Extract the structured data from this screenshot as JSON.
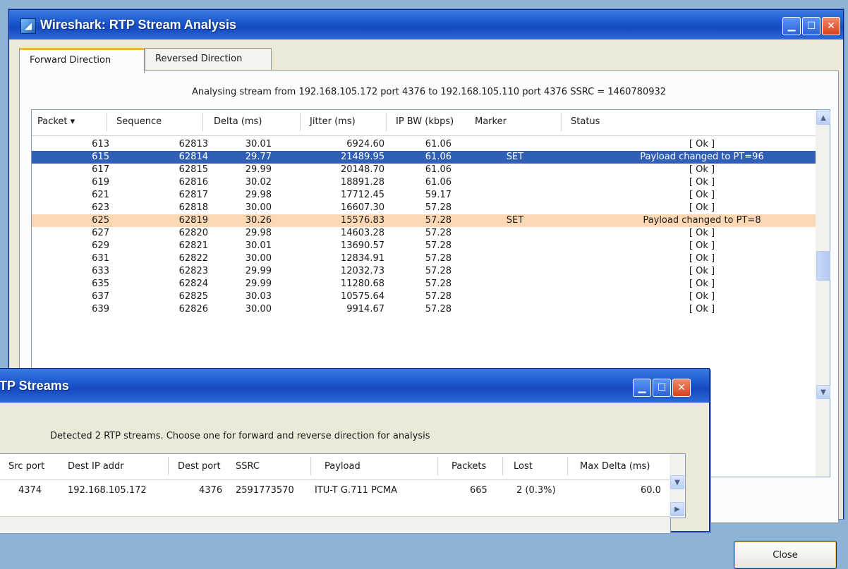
{
  "main_window": {
    "title": "Wireshark: RTP Stream Analysis",
    "tabs": [
      {
        "label": "Forward Direction",
        "active": true
      },
      {
        "label": "Reversed Direction",
        "active": false
      }
    ],
    "analysing_text": "Analysing stream from  192.168.105.172 port 4376  to  192.168.105.110 port 4376  SSRC = 1460780932",
    "columns": [
      "Packet ▾",
      "Sequence",
      "Delta (ms)",
      "Jitter (ms)",
      "IP BW (kbps)",
      "Marker",
      "Status"
    ],
    "rows": [
      {
        "packet": "613",
        "seq": "62813",
        "delta": "30.01",
        "jitter": "6924.60",
        "bw": "61.06",
        "marker": "",
        "status": "[ Ok ]",
        "state": "normal"
      },
      {
        "packet": "615",
        "seq": "62814",
        "delta": "29.77",
        "jitter": "21489.95",
        "bw": "61.06",
        "marker": "SET",
        "status": "Payload changed to PT=96",
        "state": "selected"
      },
      {
        "packet": "617",
        "seq": "62815",
        "delta": "29.99",
        "jitter": "20148.70",
        "bw": "61.06",
        "marker": "",
        "status": "[ Ok ]",
        "state": "normal"
      },
      {
        "packet": "619",
        "seq": "62816",
        "delta": "30.02",
        "jitter": "18891.28",
        "bw": "61.06",
        "marker": "",
        "status": "[ Ok ]",
        "state": "normal"
      },
      {
        "packet": "621",
        "seq": "62817",
        "delta": "29.98",
        "jitter": "17712.45",
        "bw": "59.17",
        "marker": "",
        "status": "[ Ok ]",
        "state": "normal"
      },
      {
        "packet": "623",
        "seq": "62818",
        "delta": "30.00",
        "jitter": "16607.30",
        "bw": "57.28",
        "marker": "",
        "status": "[ Ok ]",
        "state": "normal"
      },
      {
        "packet": "625",
        "seq": "62819",
        "delta": "30.26",
        "jitter": "15576.83",
        "bw": "57.28",
        "marker": "SET",
        "status": "Payload changed to PT=8",
        "state": "warning"
      },
      {
        "packet": "627",
        "seq": "62820",
        "delta": "29.98",
        "jitter": "14603.28",
        "bw": "57.28",
        "marker": "",
        "status": "[ Ok ]",
        "state": "normal"
      },
      {
        "packet": "629",
        "seq": "62821",
        "delta": "30.01",
        "jitter": "13690.57",
        "bw": "57.28",
        "marker": "",
        "status": "[ Ok ]",
        "state": "normal"
      },
      {
        "packet": "631",
        "seq": "62822",
        "delta": "30.00",
        "jitter": "12834.91",
        "bw": "57.28",
        "marker": "",
        "status": "[ Ok ]",
        "state": "normal"
      },
      {
        "packet": "633",
        "seq": "62823",
        "delta": "29.99",
        "jitter": "12032.73",
        "bw": "57.28",
        "marker": "",
        "status": "[ Ok ]",
        "state": "normal"
      },
      {
        "packet": "635",
        "seq": "62824",
        "delta": "29.99",
        "jitter": "11280.68",
        "bw": "57.28",
        "marker": "",
        "status": "[ Ok ]",
        "state": "normal"
      },
      {
        "packet": "637",
        "seq": "62825",
        "delta": "30.03",
        "jitter": "10575.64",
        "bw": "57.28",
        "marker": "",
        "status": "[ Ok ]",
        "state": "normal"
      },
      {
        "packet": "639",
        "seq": "62826",
        "delta": "30.00",
        "jitter": "9914.67",
        "bw": "57.28",
        "marker": "",
        "status": "[ Ok ]",
        "state": "normal"
      }
    ],
    "close_label": "Close",
    "colors": {
      "selected_row": "#2f5fb6",
      "warning_row": "#fcd8b4",
      "titlebar": "#1d59cf"
    }
  },
  "streams_window": {
    "title": "TP Streams",
    "detected_text": "Detected 2 RTP streams. Choose one for forward and reverse direction for analysis",
    "columns": [
      "Src port",
      "Dest IP addr",
      "Dest port",
      "SSRC",
      "Payload",
      "Packets",
      "Lost",
      "Max Delta (ms)"
    ],
    "row": {
      "src_port": "4374",
      "dest_ip": "192.168.105.172",
      "dest_port": "4376",
      "ssrc": "2591773570",
      "payload": "ITU-T G.711 PCMA",
      "packets": "665",
      "lost": "2 (0.3%)",
      "max_delta": "60.0"
    }
  }
}
